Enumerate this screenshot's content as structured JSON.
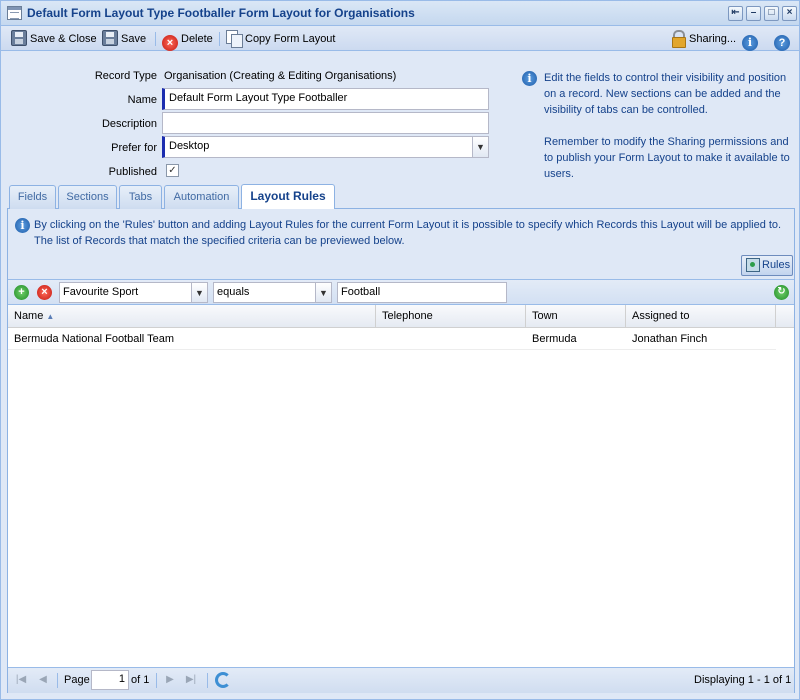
{
  "window": {
    "title": "Default Form Layout Type Footballer Form Layout for Organisations",
    "controls": [
      "restore",
      "minimize",
      "maximize",
      "close"
    ]
  },
  "toolbar": {
    "save_close_label": "Save & Close",
    "save_label": "Save",
    "delete_label": "Delete",
    "copy_label": "Copy Form Layout",
    "sharing_label": "Sharing..."
  },
  "form": {
    "record_type_label": "Record Type",
    "record_type_value": "Organisation (Creating & Editing Organisations)",
    "name_label": "Name",
    "name_value": "Default Form Layout Type Footballer",
    "description_label": "Description",
    "description_value": "",
    "prefer_label": "Prefer for",
    "prefer_value": "Desktop",
    "published_label": "Published",
    "published_checked": true
  },
  "info": {
    "paragraph1": "Edit the fields to control their visibility and position on a record. New sections can be added and the visibility of tabs can be controlled.",
    "paragraph2": "Remember to modify the Sharing permissions and to publish your Form Layout to make it available to users."
  },
  "tabs": [
    {
      "label": "Fields",
      "active": false
    },
    {
      "label": "Sections",
      "active": false
    },
    {
      "label": "Tabs",
      "active": false
    },
    {
      "label": "Automation",
      "active": false
    },
    {
      "label": "Layout Rules",
      "active": true
    }
  ],
  "layout_rules": {
    "note": "By clicking on the 'Rules' button and adding Layout Rules for the current Form Layout it is possible to specify which Records this Layout will be applied to. The list of Records that match the specified criteria can be previewed below.",
    "rules_button_label": "Rules",
    "filter": {
      "field": "Favourite Sport",
      "operator": "equals",
      "value": "Football"
    },
    "columns": [
      "Name",
      "Telephone",
      "Town",
      "Assigned to"
    ],
    "sorted_column": "Name",
    "rows": [
      {
        "name": "Bermuda National Football Team",
        "telephone": "",
        "town": "Bermuda",
        "assigned_to": "Jonathan Finch"
      }
    ]
  },
  "pager": {
    "page_label": "Page",
    "page_value": "1",
    "of_label": "of 1",
    "display_text": "Displaying 1 - 1 of 1"
  }
}
